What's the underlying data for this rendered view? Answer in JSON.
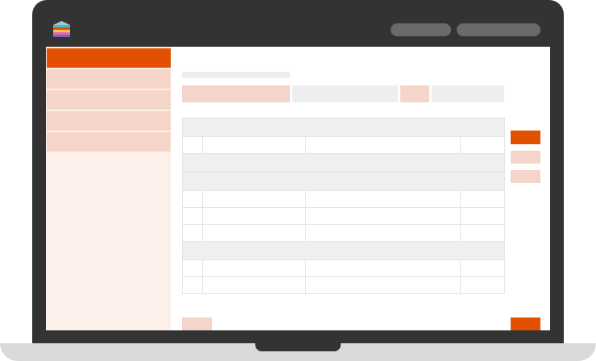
{
  "colors": {
    "accent": "#e35000",
    "accent_light": "#f5d5c9",
    "sidebar_bg": "#fdf0ea",
    "topbar_bg": "#333333",
    "neutral": "#eeeeee"
  },
  "header": {
    "logo_icon": "stacked-books-logo-icon",
    "pills": [
      "",
      ""
    ]
  },
  "sidebar": {
    "items": [
      {
        "label": "",
        "active": true
      },
      {
        "label": "",
        "active": false
      },
      {
        "label": "",
        "active": false
      },
      {
        "label": "",
        "active": false
      },
      {
        "label": "",
        "active": false
      }
    ]
  },
  "main": {
    "heading": "",
    "tabs": [
      {
        "label": "",
        "selected": true
      },
      {
        "label": "",
        "selected": false
      },
      {
        "label": "",
        "selected": true
      },
      {
        "label": "",
        "selected": false
      }
    ],
    "table": {
      "rows": [
        {
          "type": "group",
          "label": ""
        },
        {
          "type": "data",
          "cells": [
            "",
            "",
            "",
            ""
          ]
        },
        {
          "type": "group",
          "label": ""
        },
        {
          "type": "group",
          "label": ""
        },
        {
          "type": "data",
          "cells": [
            "",
            "",
            "",
            ""
          ]
        },
        {
          "type": "data",
          "cells": [
            "",
            "",
            "",
            ""
          ]
        },
        {
          "type": "data",
          "cells": [
            "",
            "",
            "",
            ""
          ]
        },
        {
          "type": "group",
          "label": ""
        },
        {
          "type": "data",
          "cells": [
            "",
            "",
            "",
            ""
          ]
        },
        {
          "type": "data",
          "cells": [
            "",
            "",
            "",
            ""
          ]
        }
      ]
    },
    "side_actions": [
      "",
      "",
      ""
    ],
    "footer": {
      "left_button": "",
      "right_button": ""
    }
  }
}
